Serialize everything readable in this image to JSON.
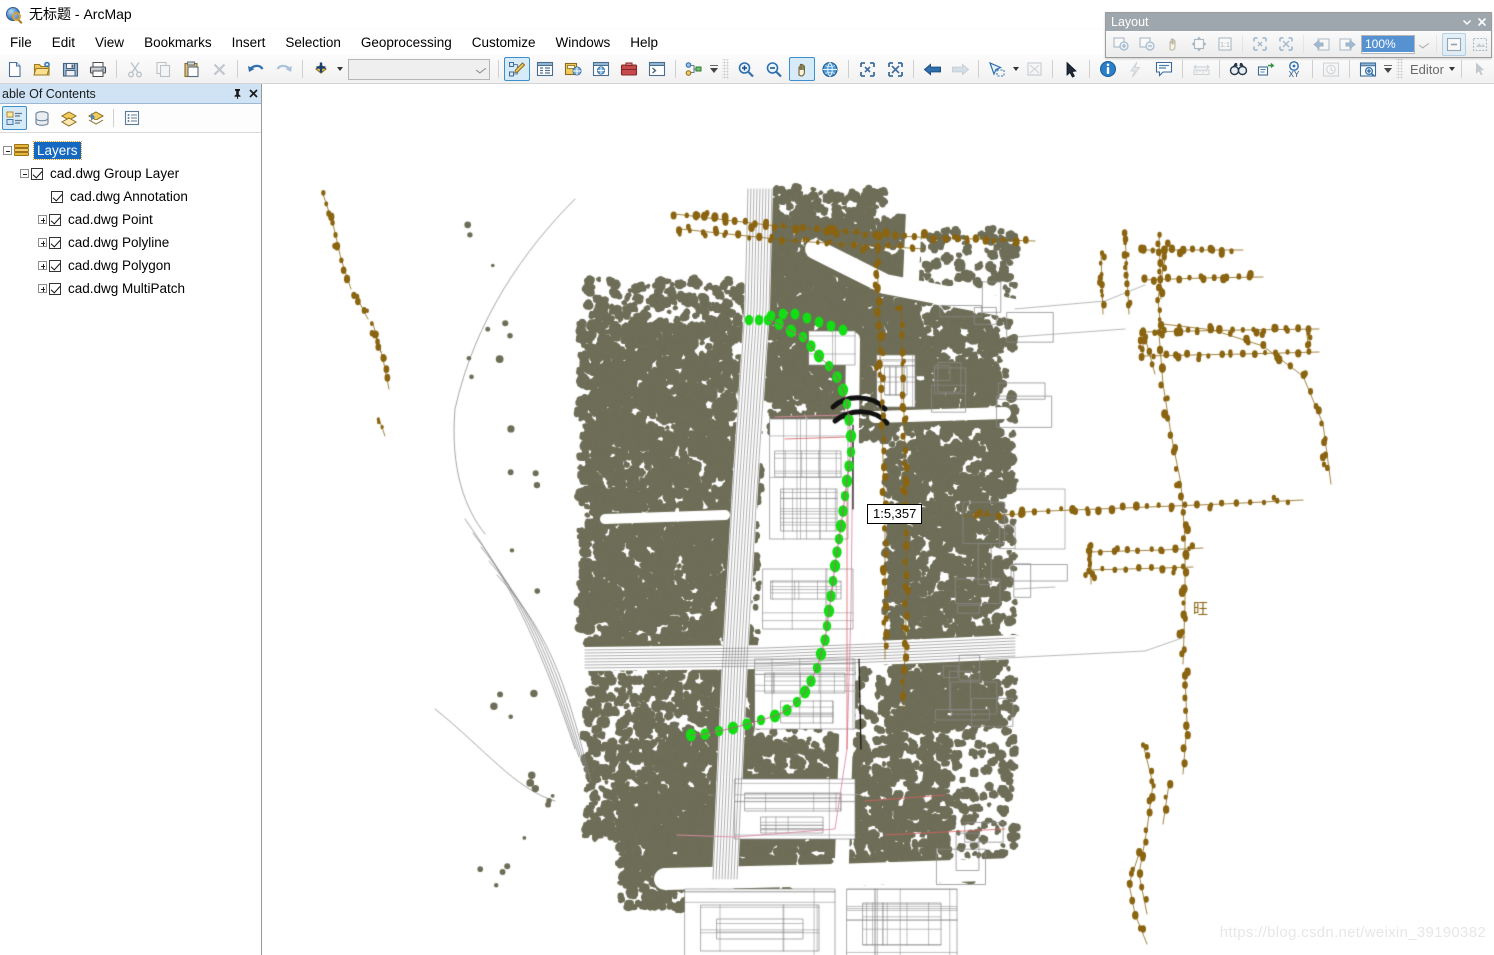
{
  "window": {
    "title": "无标题 - ArcMap",
    "app_icon": "arcmap-globe-icon"
  },
  "menu": {
    "items": [
      {
        "label": "File"
      },
      {
        "label": "Edit"
      },
      {
        "label": "View"
      },
      {
        "label": "Bookmarks"
      },
      {
        "label": "Insert"
      },
      {
        "label": "Selection"
      },
      {
        "label": "Geoprocessing"
      },
      {
        "label": "Customize"
      },
      {
        "label": "Windows"
      },
      {
        "label": "Help"
      }
    ]
  },
  "standard_toolbar": {
    "scale_combo_value": "",
    "scale_combo_placeholder": "",
    "buttons": [
      {
        "name": "new-map-button",
        "title": "New Map File"
      },
      {
        "name": "open-button",
        "title": "Open"
      },
      {
        "name": "save-button",
        "title": "Save"
      },
      {
        "name": "print-button",
        "title": "Print"
      },
      {
        "name": "cut-button",
        "title": "Cut"
      },
      {
        "name": "copy-button",
        "title": "Copy"
      },
      {
        "name": "paste-button",
        "title": "Paste"
      },
      {
        "name": "delete-button",
        "title": "Delete"
      },
      {
        "name": "undo-button",
        "title": "Undo"
      },
      {
        "name": "redo-button",
        "title": "Redo"
      },
      {
        "name": "add-data-button",
        "title": "Add Data"
      },
      {
        "name": "editor-toolbox-button",
        "title": "Editor Toolbar"
      },
      {
        "name": "table-of-contents-button",
        "title": "Table Of Contents"
      },
      {
        "name": "catalog-button",
        "title": "Catalog"
      },
      {
        "name": "search-window-button",
        "title": "Search"
      },
      {
        "name": "arctoolbox-button",
        "title": "ArcToolbox"
      },
      {
        "name": "python-window-button",
        "title": "Python Window"
      },
      {
        "name": "model-builder-button",
        "title": "ModelBuilder"
      }
    ]
  },
  "tools_toolbar": {
    "buttons": [
      {
        "name": "zoom-in-button",
        "title": "Zoom In"
      },
      {
        "name": "zoom-out-button",
        "title": "Zoom Out"
      },
      {
        "name": "pan-button",
        "title": "Pan",
        "active": true
      },
      {
        "name": "full-extent-button",
        "title": "Full Extent"
      },
      {
        "name": "fixed-zoom-in-button",
        "title": "Fixed Zoom In"
      },
      {
        "name": "fixed-zoom-out-button",
        "title": "Fixed Zoom Out"
      },
      {
        "name": "go-back-extent-button",
        "title": "Go Back To Previous Extent"
      },
      {
        "name": "go-next-extent-button",
        "title": "Go To Next Extent"
      },
      {
        "name": "select-features-button",
        "title": "Select Features"
      },
      {
        "name": "clear-selection-button",
        "title": "Clear Selected Features"
      },
      {
        "name": "select-elements-button",
        "title": "Select Elements"
      },
      {
        "name": "identify-button",
        "title": "Identify"
      },
      {
        "name": "hyperlink-button",
        "title": "Hyperlink"
      },
      {
        "name": "html-popup-button",
        "title": "HTML Popup"
      },
      {
        "name": "measure-button",
        "title": "Measure"
      },
      {
        "name": "find-button",
        "title": "Find"
      },
      {
        "name": "find-route-button",
        "title": "Find Route"
      },
      {
        "name": "go-to-xy-button",
        "title": "Go To XY"
      },
      {
        "name": "time-slider-button",
        "title": "Time Slider"
      },
      {
        "name": "create-viewer-window-button",
        "title": "Create Viewer Window"
      }
    ]
  },
  "editor_toolbar": {
    "menu_label": "Editor",
    "buttons": [
      {
        "name": "edit-tool-button",
        "title": "Edit Tool"
      },
      {
        "name": "edit-annotation-tool-button",
        "title": "Edit Annotation Tool"
      },
      {
        "name": "straight-segment-button",
        "title": "Straight Segment"
      },
      {
        "name": "curve-segment-button",
        "title": "Curve Segment"
      },
      {
        "name": "create-features-button",
        "title": "Construction Tools"
      },
      {
        "name": "edit-vertices-button",
        "title": "Edit Vertices"
      },
      {
        "name": "reshape-feature-button",
        "title": "Reshape Feature Tool"
      },
      {
        "name": "cut-polygons-button",
        "title": "Cut Polygons Tool"
      },
      {
        "name": "split-tool-button",
        "title": "Split Tool"
      },
      {
        "name": "rotate-tool-button",
        "title": "Rotate Tool"
      },
      {
        "name": "attributes-button",
        "title": "Attributes"
      }
    ]
  },
  "layout_toolbar": {
    "title": "Layout",
    "zoom_value": "100%",
    "buttons": [
      {
        "name": "layout-zoom-in-button",
        "title": "Zoom In"
      },
      {
        "name": "layout-zoom-out-button",
        "title": "Zoom Out"
      },
      {
        "name": "layout-pan-button",
        "title": "Pan"
      },
      {
        "name": "layout-zoom-whole-page-button",
        "title": "Zoom Whole Page"
      },
      {
        "name": "layout-zoom-100-button",
        "title": "Zoom To 100%"
      },
      {
        "name": "layout-fixed-zoom-in-button",
        "title": "Fixed Zoom In"
      },
      {
        "name": "layout-fixed-zoom-out-button",
        "title": "Fixed Zoom Out"
      },
      {
        "name": "layout-go-back-extent-button",
        "title": "Go Back To Extent"
      },
      {
        "name": "layout-go-forward-extent-button",
        "title": "Go Forward To Extent"
      },
      {
        "name": "layout-toggle-draft-mode-button",
        "title": "Toggle Draft Mode"
      },
      {
        "name": "layout-focus-data-frame-button",
        "title": "Focus Data Frame"
      },
      {
        "name": "layout-change-layout-button",
        "title": "Change Layout"
      },
      {
        "name": "layout-data-driven-pages-button",
        "title": "Data Driven Pages"
      }
    ]
  },
  "table_of_contents": {
    "title": "able Of Contents",
    "pin_icon": "pin-icon",
    "close_icon": "close-icon",
    "tabs": [
      {
        "name": "list-by-drawing-order",
        "label": "List By Drawing Order",
        "selected": true
      },
      {
        "name": "list-by-source",
        "label": "List By Source",
        "selected": false
      },
      {
        "name": "list-by-visibility",
        "label": "List By Visibility",
        "selected": false
      },
      {
        "name": "list-by-selection",
        "label": "List By Selection",
        "selected": false
      },
      {
        "name": "toc-options",
        "label": "Options",
        "selected": false
      }
    ],
    "tree": {
      "root": {
        "label": "Layers",
        "selected": true,
        "expanded": true
      },
      "items": [
        {
          "label": "cad.dwg Group Layer",
          "checked": true,
          "indent": 1,
          "toggle": "minus"
        },
        {
          "label": "cad.dwg Annotation",
          "checked": true,
          "indent": 2,
          "toggle": "none"
        },
        {
          "label": "cad.dwg Point",
          "checked": true,
          "indent": 2,
          "toggle": "plus"
        },
        {
          "label": "cad.dwg Polyline",
          "checked": true,
          "indent": 2,
          "toggle": "plus"
        },
        {
          "label": "cad.dwg Polygon",
          "checked": true,
          "indent": 2,
          "toggle": "plus"
        },
        {
          "label": "cad.dwg MultiPatch",
          "checked": true,
          "indent": 2,
          "toggle": "plus"
        }
      ]
    }
  },
  "map": {
    "scale_tooltip": "1:5,357",
    "annotation_text": "旺",
    "watermark": "https://blog.csdn.net/weixin_39190382",
    "colors": {
      "vegetation": "#6e6e58",
      "selection_green": "#13dd13",
      "annotation_brown": "#8a6410",
      "line_grey": "#8a8a8a",
      "highlight_pink": "#e08aa8",
      "background": "#ffffff"
    }
  }
}
